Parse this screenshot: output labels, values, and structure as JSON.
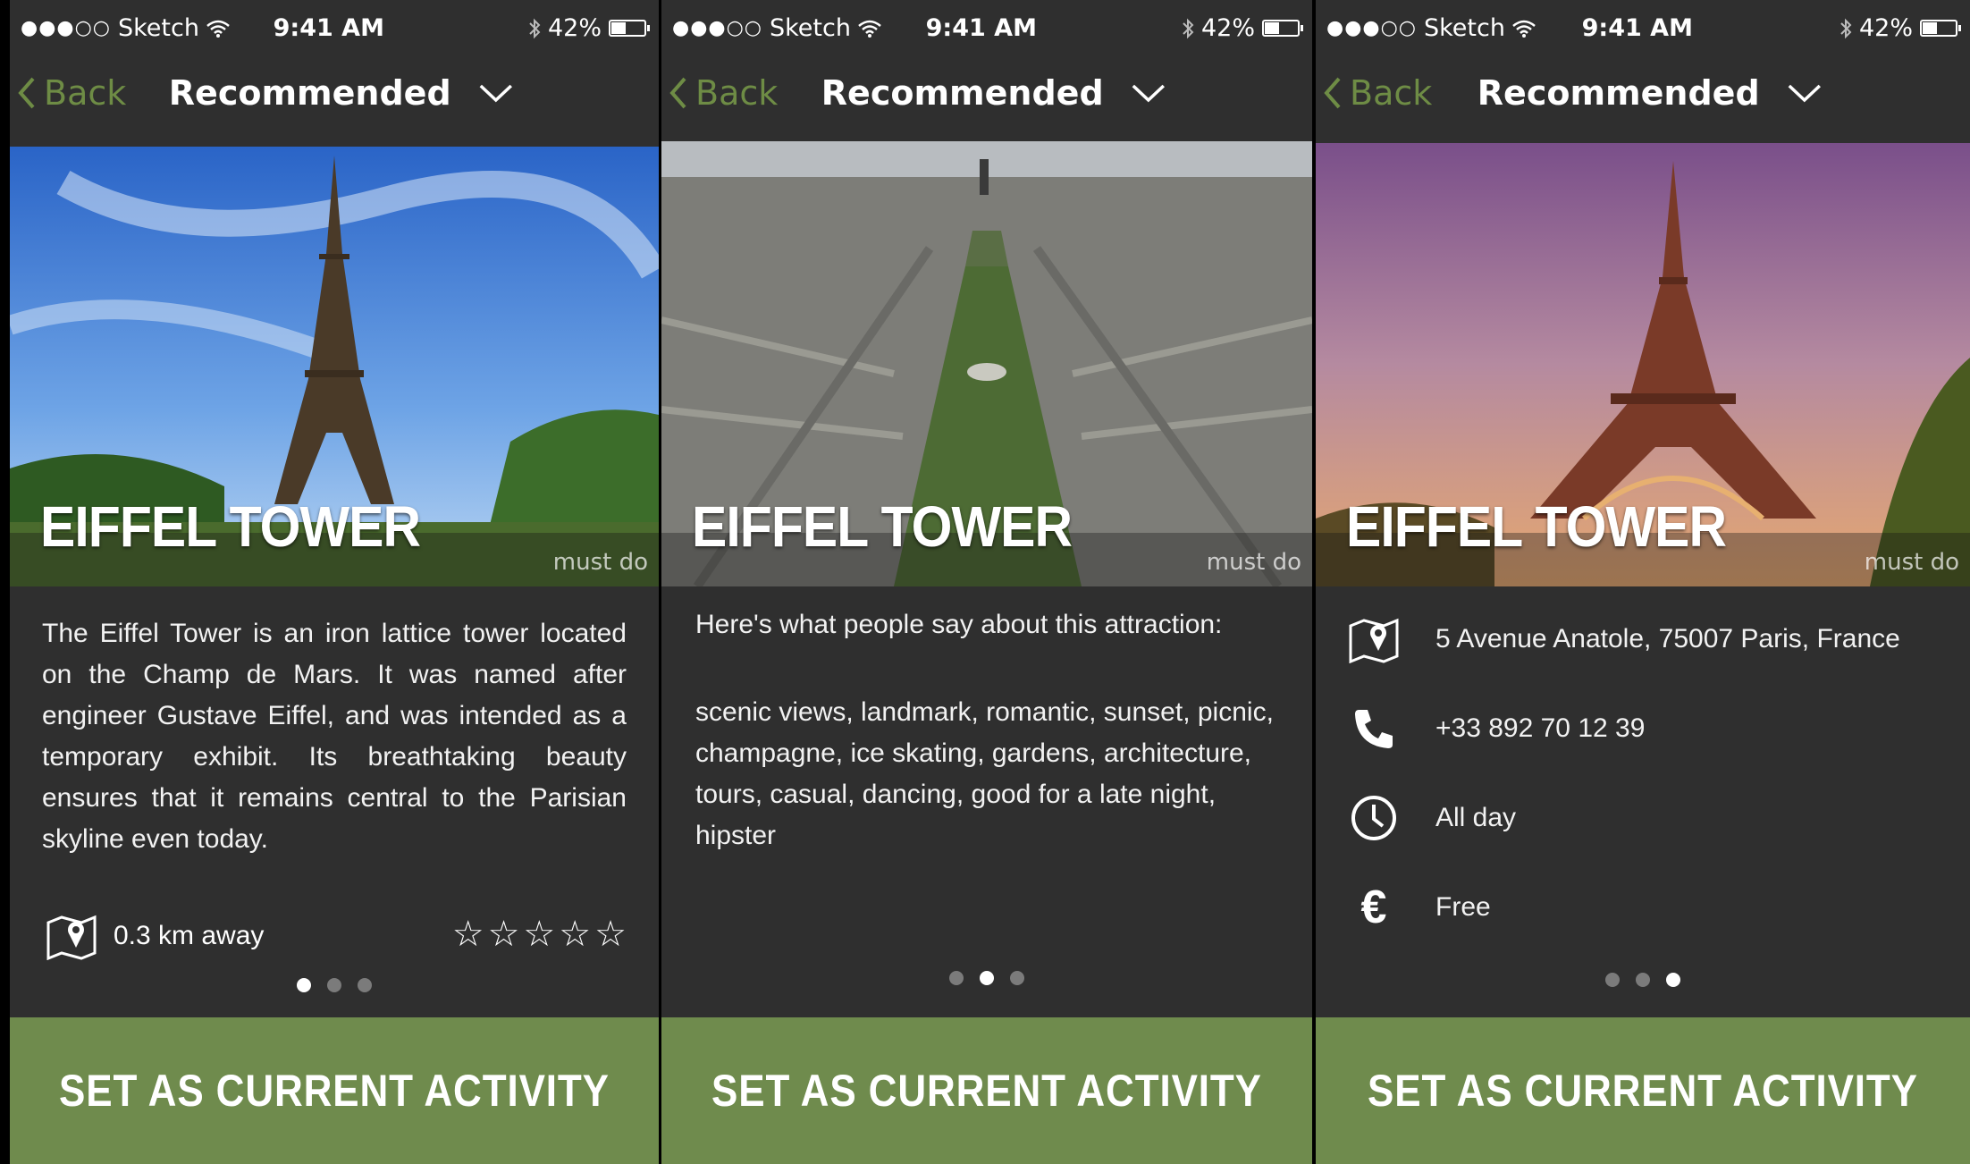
{
  "status_bar": {
    "carrier": "Sketch",
    "signal_dots": "●●●○○",
    "time": "9:41 AM",
    "battery": "42%",
    "battery_level": 0.42
  },
  "nav": {
    "back_label": "Back",
    "title": "Recommended"
  },
  "hero": {
    "title": "EIFFEL TOWER",
    "tag": "must do"
  },
  "screens": [
    {
      "description": "The Eiffel Tower is an iron lattice tower located on the Champ de Mars. It was named after engineer Gustave Eiffel, and was intended as a temporary exhibit. Its breathtaking beauty ensures that it remains central to the Parisian skyline even today.",
      "distance": "0.3 km away",
      "rating": 0,
      "rating_max": 5
    },
    {
      "intro": "Here's what people say about this attraction:",
      "tags": "scenic views, landmark, romantic, sunset, picnic, champagne, ice skating, gardens, architecture, tours, casual, dancing, good for a late night, hipster"
    },
    {
      "address": "5 Avenue Anatole, 75007 Paris, France",
      "phone": "+33 892 70 12 39",
      "hours": "All day",
      "price": "Free"
    }
  ],
  "pager": {
    "count": 3
  },
  "cta_label": "SET AS CURRENT ACTIVITY",
  "colors": {
    "accent_green": "#6f8b4d",
    "back_green": "#6e8c45",
    "background": "#2f2f2f"
  },
  "icons": [
    "wifi-icon",
    "bluetooth-icon",
    "battery-icon",
    "chevron-left-icon",
    "chevron-down-icon",
    "map-pin-icon",
    "phone-icon",
    "clock-icon",
    "euro-icon",
    "star-icon"
  ]
}
